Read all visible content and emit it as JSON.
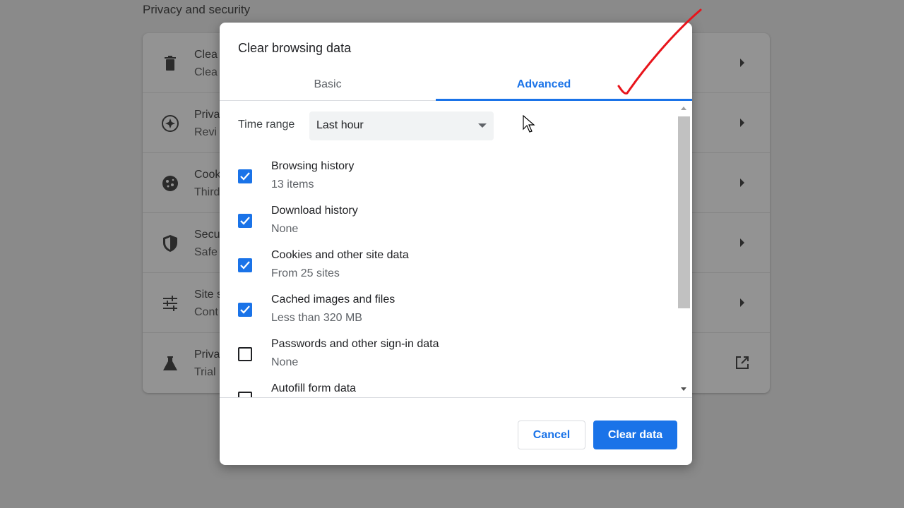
{
  "background": {
    "section_title": "Privacy and security",
    "rows": [
      {
        "title": "Clea",
        "subtitle": "Clea",
        "icon": "trash-icon"
      },
      {
        "title": "Priva",
        "subtitle": "Revi",
        "icon": "compass-icon"
      },
      {
        "title": "Cook",
        "subtitle": "Third",
        "icon": "cookie-icon"
      },
      {
        "title": "Secu",
        "subtitle": "Safe",
        "icon": "shield-icon"
      },
      {
        "title": "Site s",
        "subtitle": "Cont",
        "icon": "sliders-icon"
      },
      {
        "title": "Priva",
        "subtitle": "Trial",
        "icon": "flask-icon"
      }
    ]
  },
  "dialog": {
    "title": "Clear browsing data",
    "tabs": {
      "basic": "Basic",
      "advanced": "Advanced",
      "active": "advanced"
    },
    "time_range": {
      "label": "Time range",
      "value": "Last hour"
    },
    "items": [
      {
        "label": "Browsing history",
        "detail": "13 items",
        "checked": true
      },
      {
        "label": "Download history",
        "detail": "None",
        "checked": true
      },
      {
        "label": "Cookies and other site data",
        "detail": "From 25 sites",
        "checked": true
      },
      {
        "label": "Cached images and files",
        "detail": "Less than 320 MB",
        "checked": true
      },
      {
        "label": "Passwords and other sign-in data",
        "detail": "None",
        "checked": false
      },
      {
        "label": "Autofill form data",
        "detail": "",
        "checked": false
      }
    ],
    "buttons": {
      "cancel": "Cancel",
      "clear": "Clear data"
    }
  },
  "colors": {
    "accent": "#1a73e8",
    "annotation": "#e8141b",
    "overlay": "#8a8a8a"
  }
}
